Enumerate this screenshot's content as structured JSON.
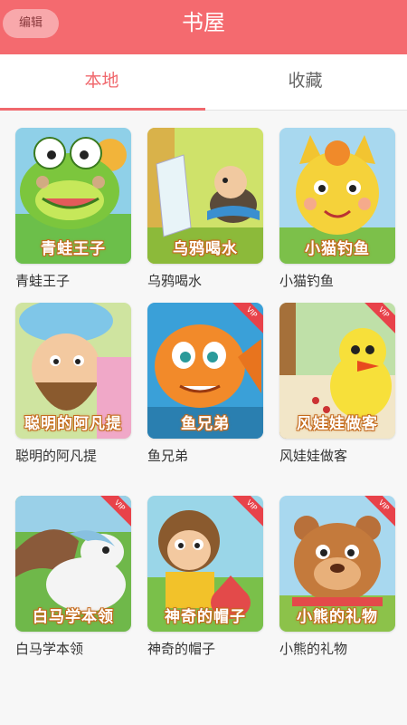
{
  "header": {
    "edit_label": "编辑",
    "title": "书屋",
    "bg_color": "#f46a6f"
  },
  "tabs": [
    {
      "label": "本地",
      "active": true
    },
    {
      "label": "收藏",
      "active": false
    }
  ],
  "books": [
    {
      "title": "青蛙王子",
      "cover_text": "青蛙王子",
      "vip": false,
      "cover_icon": "frog-icon"
    },
    {
      "title": "乌鸦喝水",
      "cover_text": "乌鸦喝水",
      "vip": false,
      "cover_icon": "crow-icon"
    },
    {
      "title": "小猫钓鱼",
      "cover_text": "小猫钓鱼",
      "vip": false,
      "cover_icon": "cat-icon"
    },
    {
      "title": "聪明的阿凡提",
      "cover_text": "聪明的阿凡提",
      "vip": false,
      "cover_icon": "man-icon"
    },
    {
      "title": "鱼兄弟",
      "cover_text": "鱼兄弟",
      "vip": true,
      "vip_text": "VIP",
      "cover_icon": "fish-icon"
    },
    {
      "title": "风娃娃做客",
      "cover_text": "风娃娃做客",
      "vip": true,
      "vip_text": "VIP",
      "cover_icon": "chick-icon"
    },
    {
      "title": "白马学本领",
      "cover_text": "白马学本领",
      "vip": true,
      "vip_text": "VIP",
      "cover_icon": "horse-icon"
    },
    {
      "title": "神奇的帽子",
      "cover_text": "神奇的帽子",
      "vip": true,
      "vip_text": "VIP",
      "cover_icon": "monkey-icon"
    },
    {
      "title": "小熊的礼物",
      "cover_text": "小熊的礼物",
      "vip": true,
      "vip_text": "VIP",
      "cover_icon": "bear-icon"
    }
  ]
}
